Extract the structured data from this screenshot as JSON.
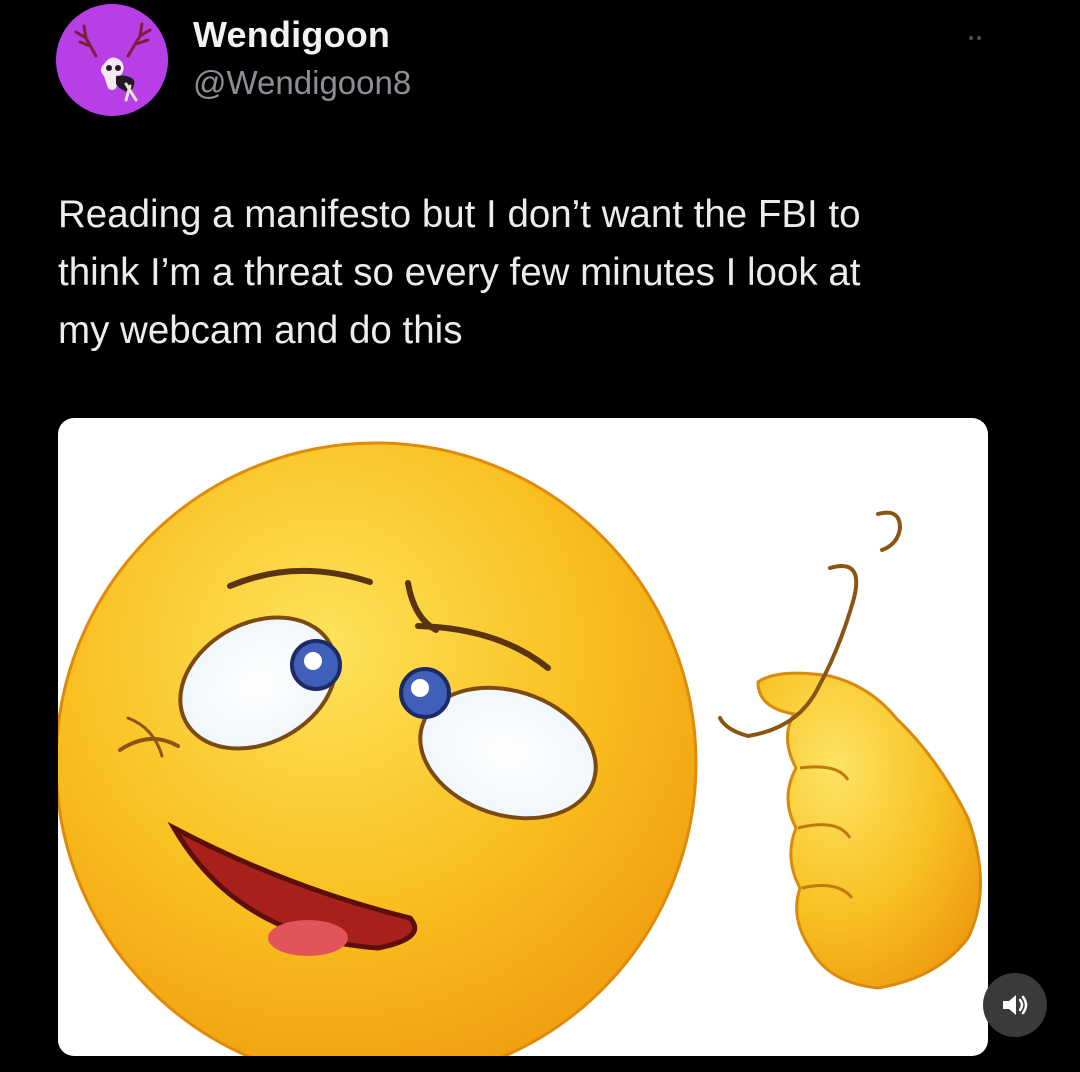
{
  "post": {
    "author": {
      "display_name": "Wendigoon",
      "handle": "@Wendigoon8",
      "avatar_icon": "deer-skull-avatar-icon",
      "avatar_color": "#b83fe6"
    },
    "more_icon": "ellipsis-icon",
    "text": "Reading a manifesto but I don’t want the FBI to\nthink I’m a threat so every few minutes I look at\nmy webcam and do this",
    "media": {
      "type": "image",
      "subject": "twirling-finger-crazy-emoji",
      "face_color": "#f7b51b",
      "background_color": "#ffffff"
    },
    "volume_icon": "speaker-volume-icon"
  },
  "colors": {
    "background": "#000000",
    "text_primary": "#ececec",
    "text_secondary": "#8b8f94"
  }
}
